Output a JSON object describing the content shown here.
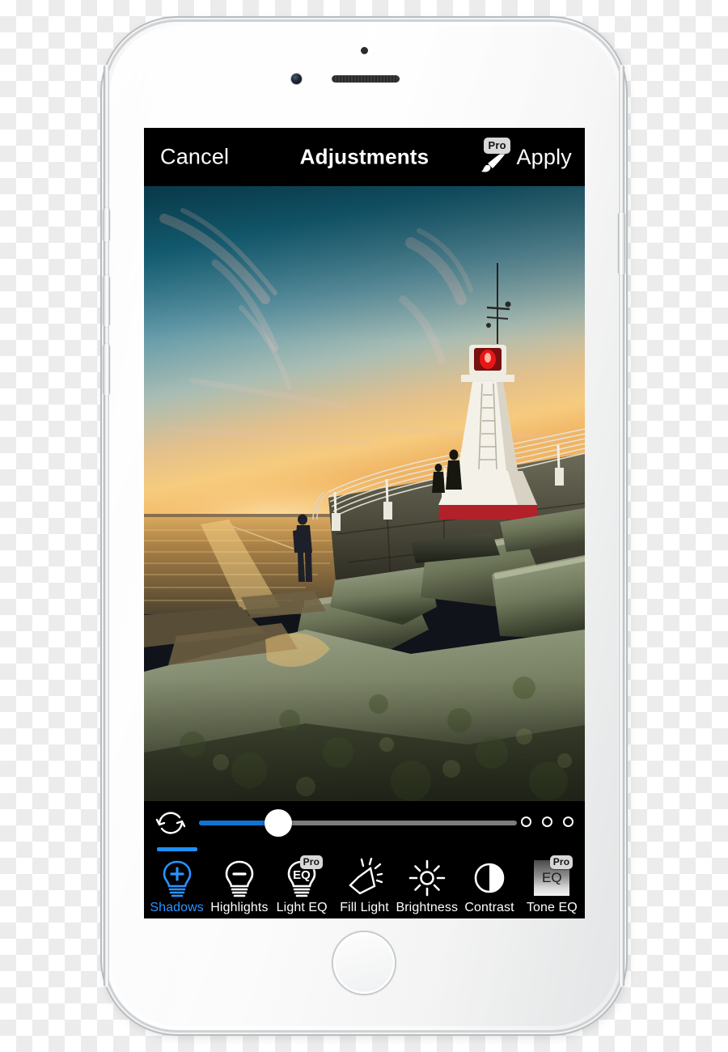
{
  "app": {
    "navbar": {
      "cancel_label": "Cancel",
      "title": "Adjustments",
      "apply_label": "Apply",
      "pro_badge": "Pro",
      "brush_icon": "brush-icon"
    },
    "photo": {
      "description": "Lighthouse on a rocky breakwater at sunset with a fisherman silhouette",
      "sky_top_color": "#0f5d78",
      "sky_horizon_color": "#f5c06a",
      "rock_color": "#6d7358",
      "lighthouse_color": "#f2efe8",
      "lamp_color": "#e01b1b"
    },
    "controls": {
      "reset_icon": "reset-circular-arrows-icon",
      "slider": {
        "value_percent": 25,
        "fill_color": "#1273d4",
        "track_color": "#7d7d7d"
      },
      "page_dots": [
        "dot-1",
        "dot-2",
        "dot-3"
      ],
      "active_tool": "Shadows",
      "accent_color": "#2a93ff",
      "tools": [
        {
          "label": "Shadows",
          "icon": "bulb-plus-icon",
          "pro": false,
          "active": true
        },
        {
          "label": "Highlights",
          "icon": "bulb-minus-icon",
          "pro": false,
          "active": false
        },
        {
          "label": "Light EQ",
          "icon": "bulb-eq-icon",
          "pro": true,
          "active": false,
          "pro_badge": "Pro"
        },
        {
          "label": "Fill Light",
          "icon": "fill-light-icon",
          "pro": false,
          "active": false
        },
        {
          "label": "Brightness",
          "icon": "sun-icon",
          "pro": false,
          "active": false
        },
        {
          "label": "Contrast",
          "icon": "contrast-circle-icon",
          "pro": false,
          "active": false
        },
        {
          "label": "Tone EQ",
          "icon": "tone-eq-gradient-icon",
          "pro": true,
          "active": false,
          "pro_badge": "Pro",
          "icon_text": "EQ"
        }
      ]
    }
  },
  "device": {
    "model_appearance": "white-silver-smartphone",
    "home_button": "home-button",
    "front_camera": "front-camera-icon",
    "earpiece": "earpiece-speaker",
    "proximity_sensor": "proximity-sensor"
  }
}
